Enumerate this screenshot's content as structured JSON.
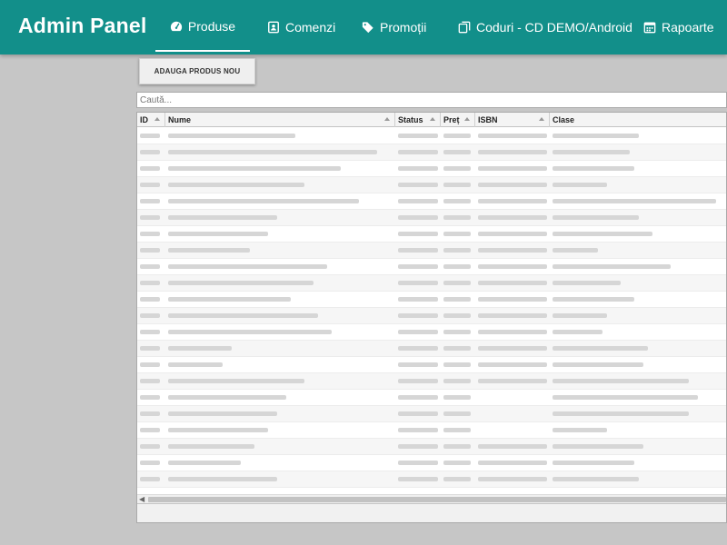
{
  "app": {
    "title": "Admin Panel"
  },
  "nav": {
    "items": [
      {
        "label": "Produse",
        "icon": "dashboard-icon",
        "active": true
      },
      {
        "label": "Comenzi",
        "icon": "contact-card-icon",
        "active": false
      },
      {
        "label": "Promoții",
        "icon": "tag-icon",
        "active": false
      },
      {
        "label": "Coduri - CD DEMO/Android",
        "icon": "copy-icon",
        "active": false
      },
      {
        "label": "Rapoarte",
        "icon": "calendar-icon",
        "active": false
      }
    ]
  },
  "toolbar": {
    "add_label": "ADAUGA PRODUS NOU"
  },
  "search": {
    "placeholder": "Caută..."
  },
  "table": {
    "columns": [
      "ID",
      "Nume",
      "Status",
      "Preț",
      "ISBN",
      "Clase"
    ]
  },
  "colors": {
    "header_bg": "#128f8a",
    "page_bg": "#c6c6c6"
  }
}
